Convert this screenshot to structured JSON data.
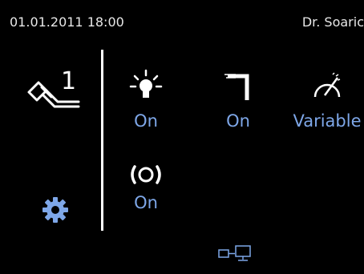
{
  "status": {
    "datetime": "01.01.2011  18:00",
    "user": "Dr. Soaric"
  },
  "handpiece": {
    "number": "1",
    "icon": "handpiece-icon"
  },
  "settings": {
    "icon": "gear-icon"
  },
  "controls": {
    "light": {
      "icon": "light-bulb-icon",
      "value": "On"
    },
    "water": {
      "icon": "water-spray-icon",
      "value": "On"
    },
    "speed": {
      "icon": "speedometer-icon",
      "value": "Variable"
    },
    "vibration": {
      "icon": "vibration-icon",
      "value": "On"
    }
  },
  "footer": {
    "icon": "monitor-connection-icon"
  },
  "colors": {
    "accent": "#7ea7e8",
    "background": "#000000",
    "text": "#ffffff"
  }
}
